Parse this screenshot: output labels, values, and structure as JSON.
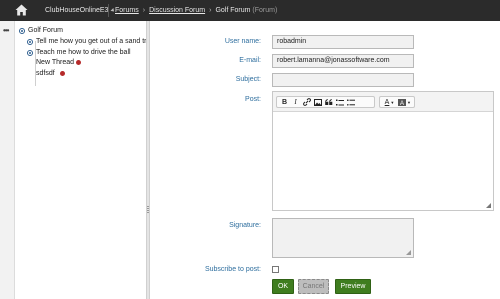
{
  "header": {
    "site_selector": "ClubHouseOnlineE3",
    "breadcrumbs": [
      "Forums",
      "Discussion Forum",
      "Golf Forum"
    ],
    "breadcrumb_suffix": "(Forum)",
    "home_icon": "home-icon"
  },
  "rail": {
    "menu_icon": "ellipsis-icon",
    "menu_text": "•••"
  },
  "tree": {
    "root": "Golf Forum",
    "items": [
      {
        "label": "Tell me how you get out of a sand trap",
        "icon": "thread-bullet-icon",
        "has_alert": false
      },
      {
        "label": "Teach me how to drive the ball",
        "icon": "thread-bullet-icon",
        "has_alert": false
      },
      {
        "label": "New Thread",
        "icon": "",
        "has_alert": true
      },
      {
        "label": "sdfsdf",
        "icon": "",
        "has_alert": true
      }
    ],
    "alert_color": "#b52a2a"
  },
  "form": {
    "username_label": "User name:",
    "username_value": "robadmin",
    "email_label": "E-mail:",
    "email_value": "robert.lamanna@jonassoftware.com",
    "subject_label": "Subject:",
    "subject_value": "",
    "post_label": "Post:",
    "signature_label": "Signature:",
    "subscribe_label": "Subscribe to post:",
    "subscribe_checked": false,
    "toolbar": {
      "bold": "B",
      "italic": "I",
      "link": "link-icon",
      "image": "image-icon",
      "quote": "quote-icon",
      "numbered_list": "numbered-list-icon",
      "bulleted_list": "bulleted-list-icon",
      "text_color": "A",
      "bg_color": "background-color-icon"
    }
  },
  "buttons": {
    "ok": "OK",
    "cancel": "Cancel",
    "preview": "Preview"
  },
  "colors": {
    "header_bg": "#2b2b2b",
    "label_blue": "#2e6e9e",
    "primary_green": "#3f7d1f"
  }
}
